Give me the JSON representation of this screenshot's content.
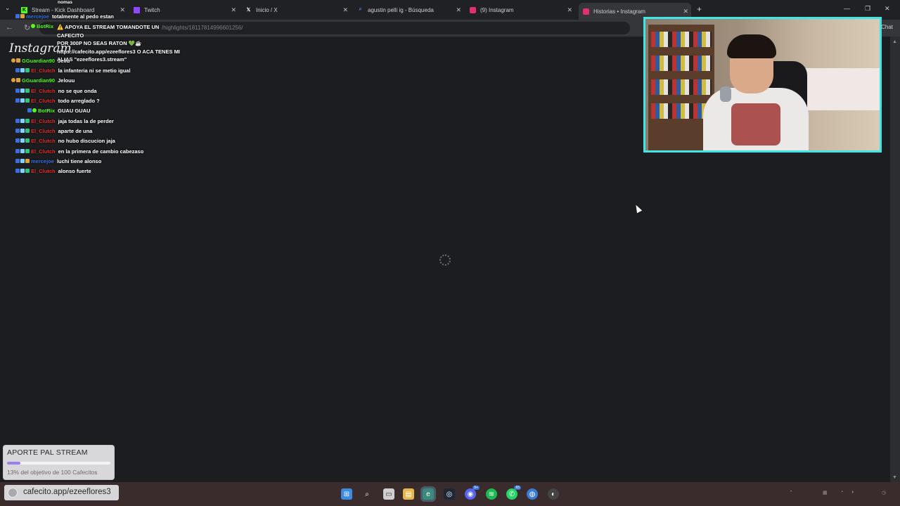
{
  "tabs": [
    {
      "label": "Stream - Kick Dashboard",
      "icon": "kick-icon",
      "color": "#53fc18"
    },
    {
      "label": "Twitch",
      "icon": "twitch-icon",
      "color": "#9146ff"
    },
    {
      "label": "Inicio / X",
      "icon": "x-icon",
      "color": "#ffffff"
    },
    {
      "label": "agustin pelli ig - Búsqueda",
      "icon": "search-icon",
      "color": "#4a90e2"
    },
    {
      "label": "(9) Instagram",
      "icon": "instagram-icon",
      "color": "#e1306c"
    },
    {
      "label": "Historias • Instagram",
      "icon": "instagram-icon",
      "color": "#e1306c"
    }
  ],
  "address": {
    "url": "/highlights/18117814996601256/"
  },
  "toolbar": {
    "chat_label": "Chat"
  },
  "page": {
    "logo": "Instagram"
  },
  "chat": {
    "top_partial": {
      "user": "mercejoe",
      "text": "totalmente al pedo estan",
      "above": "nomas"
    },
    "bot_message": {
      "user": "BotRix",
      "lines": [
        "⚠️ APOYA EL STREAM TOMANDOTE UN CAFECITO",
        "POR 300P NO SEAS RATON 💚☕",
        "https://cafecito.app/ezeeflores3 O ACA TENES MI",
        "ALIAS \"ezeeflores3.stream\""
      ]
    },
    "messages": [
      {
        "user": "GGuardian90",
        "color": "#53fc18",
        "text": "Jeliu"
      },
      {
        "user": "El_Clutch",
        "color": "#e02b2b",
        "text": "la infanteria ni se metio igual"
      },
      {
        "user": "GGuardian90",
        "color": "#53fc18",
        "text": "Jelouu"
      },
      {
        "user": "El_Clutch",
        "color": "#e02b2b",
        "text": "no se que onda"
      },
      {
        "user": "El_Clutch",
        "color": "#e02b2b",
        "text": "todo arreglado ?"
      },
      {
        "user": "BotRix",
        "color": "#53fc18",
        "text": "GUAU GUAU"
      },
      {
        "user": "El_Clutch",
        "color": "#e02b2b",
        "text": "jaja todas la de perder"
      },
      {
        "user": "El_Clutch",
        "color": "#e02b2b",
        "text": "aparte de una"
      },
      {
        "user": "El_Clutch",
        "color": "#e02b2b",
        "text": "no hubo discucion jaja"
      },
      {
        "user": "El_Clutch",
        "color": "#e02b2b",
        "text": "en la primera de cambio cabezaso"
      },
      {
        "user": "mercejoe",
        "color": "#3b6fe0",
        "text": "luchi tiene alonso"
      },
      {
        "user": "El_Clutch",
        "color": "#e02b2b",
        "text": "alonso fuerte"
      }
    ]
  },
  "donation": {
    "title": "APORTE PAL STREAM",
    "progress": 0.13,
    "text": "13% del objetivo de 100 Cafecitos"
  },
  "taskbar": {
    "cafecito_url": "cafecito.app/ezeeflores3",
    "icons": [
      "windows-icon",
      "search-icon",
      "task-view-icon",
      "file-explorer-icon",
      "edge-icon",
      "steam-icon",
      "discord-icon",
      "spotify-icon",
      "whatsapp-icon",
      "vpn-icon",
      "obs-icon"
    ],
    "badges": {
      "discord": "9+",
      "whatsapp": "65"
    }
  },
  "colors": {
    "webcam_border": "#3ee6e6",
    "accent_progress": "#9b7ff0"
  }
}
